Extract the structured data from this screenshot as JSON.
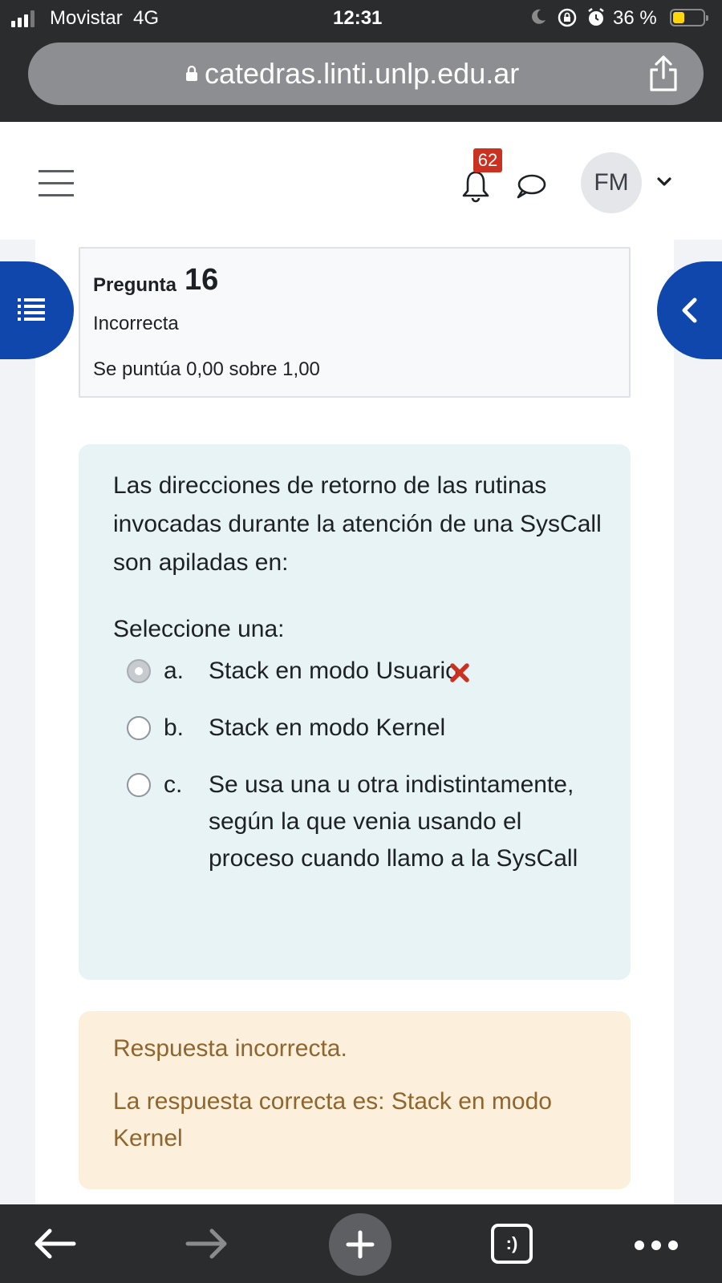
{
  "status_bar": {
    "carrier": "Movistar",
    "network": "4G",
    "time": "12:31",
    "battery": "36 %",
    "battery_level": 0.36,
    "icons": [
      "signal-icon",
      "moon-icon",
      "orientation-lock-icon",
      "alarm-icon",
      "battery-icon"
    ]
  },
  "browser": {
    "url": "catedras.linti.unlp.edu.ar",
    "icons": [
      "padlock-icon",
      "share-icon"
    ]
  },
  "header": {
    "notification_count": "62",
    "user_initials": "FM",
    "icons": [
      "hamburger-icon",
      "bell-icon",
      "chat-icon",
      "chevron-down-icon"
    ]
  },
  "question_info": {
    "label": "Pregunta",
    "number": "16",
    "state": "Incorrecta",
    "grade": "Se puntúa 0,00 sobre 1,00"
  },
  "question": {
    "text": "Las direcciones de retorno de las rutinas invocadas durante la atención de una SysCall son apiladas en:",
    "prompt": "Seleccione una:",
    "options": [
      {
        "letter": "a.",
        "text": "Stack en modo Usuario",
        "selected": true,
        "marked_incorrect": true
      },
      {
        "letter": "b.",
        "text": "Stack en modo Kernel",
        "selected": false
      },
      {
        "letter": "c.",
        "text": "Se usa una u otra indistintamente, según la que venia usando el proceso cuando llamo a la SysCall",
        "selected": false
      }
    ]
  },
  "feedback": {
    "status": "Respuesta incorrecta.",
    "correct_answer": "La respuesta correcta es: Stack en modo Kernel"
  },
  "toolbar": {
    "tabs_label": ":)",
    "icons": [
      "back-arrow-icon",
      "forward-arrow-icon",
      "new-tab-plus-icon",
      "tabs-icon",
      "more-icon"
    ]
  },
  "colors": {
    "drawer_blue": "#0f47ad",
    "badge_red": "#ca3120",
    "question_bg": "#e7f3f5",
    "feedback_bg": "#fcefdc",
    "feedback_text": "#8e662e",
    "incorrect_mark": "#ca3120"
  }
}
